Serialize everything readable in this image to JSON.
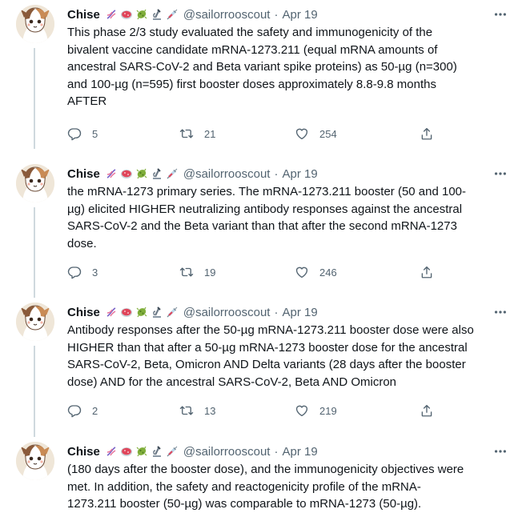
{
  "tweets": [
    {
      "name": "Chise",
      "handle": "@sailorrooscout",
      "date": "Apr 19",
      "text": "This phase 2/3 study evaluated the safety and immunogenicity of the\nbivalent vaccine candidate mRNA-1273.211 (equal mRNA amounts of\nancestral SARS-CoV-2 and Beta variant spike proteins) as 50-µg (n=300)\nand 100-µg (n=595) first booster doses approximately 8.8-9.8 months\nAFTER",
      "replies": "5",
      "retweets": "21",
      "likes": "254"
    },
    {
      "name": "Chise",
      "handle": "@sailorrooscout",
      "date": "Apr 19",
      "text": "the mRNA-1273 primary series. The mRNA-1273.211 booster (50 and 100-\nµg) elicited HIGHER neutralizing antibody responses against the ancestral\nSARS-CoV-2 and the Beta variant than that after the second mRNA-1273\ndose.",
      "replies": "3",
      "retweets": "19",
      "likes": "246"
    },
    {
      "name": "Chise",
      "handle": "@sailorrooscout",
      "date": "Apr 19",
      "text": "Antibody responses after the 50-µg mRNA-1273.211 booster dose were also\nHIGHER than that after a 50-µg mRNA-1273 booster dose for the ancestral\nSARS-CoV-2, Beta, Omicron AND Delta variants (28 days after the booster\ndose) AND for the ancestral SARS-CoV-2, Beta AND Omicron",
      "replies": "2",
      "retweets": "13",
      "likes": "219"
    },
    {
      "name": "Chise",
      "handle": "@sailorrooscout",
      "date": "Apr 19",
      "text": "(180 days after the booster dose), and the immunogenicity objectives were\nmet. In addition, the safety and reactogenicity profile of the mRNA-\n1273.211 booster (50-µg) was comparable to mRNA-1273 (50-µg).",
      "replies": "",
      "retweets": "",
      "likes": ""
    }
  ],
  "name_emojis": [
    "dna-icon",
    "petri-dish-icon",
    "microbe-icon",
    "microscope-icon",
    "syringe-icon"
  ],
  "separator": "·",
  "colors": {
    "text": "#0f1419",
    "secondary": "#536471",
    "rail": "#cfd9de"
  }
}
